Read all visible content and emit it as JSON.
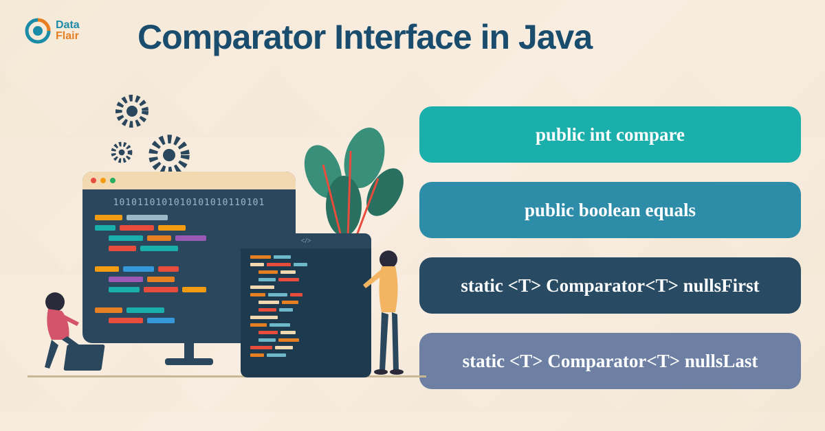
{
  "logo": {
    "brand1": "Data",
    "brand2": "Flair"
  },
  "title": "Comparator Interface in Java",
  "pills": [
    {
      "label": "public int compare"
    },
    {
      "label": "public boolean equals"
    },
    {
      "label": "static <T> Comparator<T> nullsFirst"
    },
    {
      "label": "static <T> Comparator<T> nullsLast"
    }
  ],
  "binary": "1010110101010101010110101",
  "tablet_header": "</>",
  "colors": {
    "pill1": "#1aafab",
    "pill2": "#2d8ca8",
    "pill3": "#284b63",
    "pill4": "#6d80a3",
    "title": "#1a4d6d"
  }
}
